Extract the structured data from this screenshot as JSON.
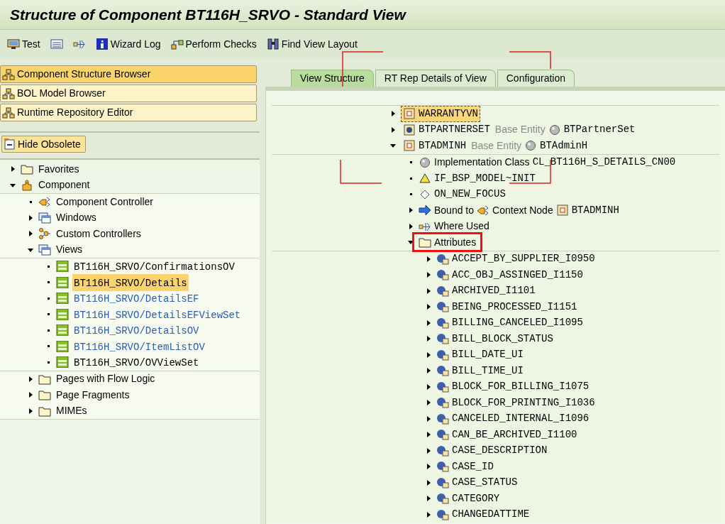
{
  "window": {
    "title": "Structure of Component BT116H_SRVO - Standard View"
  },
  "toolbar": [
    {
      "kind": "test",
      "label": "Test"
    },
    {
      "kind": "list"
    },
    {
      "kind": "where-used"
    },
    {
      "kind": "info",
      "label": "Wizard Log"
    },
    {
      "kind": "checks",
      "label": "Perform Checks"
    },
    {
      "kind": "binoculars",
      "label": "Find View Layout"
    }
  ],
  "browsers": [
    {
      "label": "Component Structure Browser",
      "selected": true
    },
    {
      "label": "BOL Model Browser",
      "selected": false
    },
    {
      "label": "Runtime Repository Editor",
      "selected": false
    }
  ],
  "hide_obsolete_button": "Hide Obsolete",
  "left_tree": [
    {
      "kind": "folder",
      "label": "Favorites",
      "expanded": false
    },
    {
      "kind": "component",
      "label": "Component",
      "expanded": true,
      "children": [
        {
          "kind": "controller",
          "label": "Component Controller"
        },
        {
          "kind": "window",
          "label": "Windows",
          "expanded": false
        },
        {
          "kind": "custom",
          "label": "Custom Controllers",
          "expanded": false
        },
        {
          "kind": "window",
          "label": "Views",
          "expanded": true,
          "children": [
            {
              "kind": "view",
              "label": "BT116H_SRVO/ConfirmationsOV",
              "selected": false,
              "color": "#000000"
            },
            {
              "kind": "view",
              "label": "BT116H_SRVO/Details",
              "selected": true,
              "color": "#000000"
            },
            {
              "kind": "view",
              "label": "BT116H_SRVO/DetailsEF",
              "selected": false,
              "color": "#2a5cb8"
            },
            {
              "kind": "view",
              "label": "BT116H_SRVO/DetailsEFViewSet",
              "selected": false,
              "color": "#2a5cb8"
            },
            {
              "kind": "view",
              "label": "BT116H_SRVO/DetailsOV",
              "selected": false,
              "color": "#2a5cb8"
            },
            {
              "kind": "view",
              "label": "BT116H_SRVO/ItemListOV",
              "selected": false,
              "color": "#2a5cb8"
            },
            {
              "kind": "view",
              "label": "BT116H_SRVO/OVViewSet",
              "selected": false,
              "color": "#000000"
            }
          ]
        },
        {
          "kind": "folder",
          "label": "Pages with Flow Logic",
          "expanded": false
        },
        {
          "kind": "folder",
          "label": "Page Fragments",
          "expanded": false
        },
        {
          "kind": "folder",
          "label": "MIMEs",
          "expanded": false
        }
      ]
    }
  ],
  "tabs": [
    {
      "label": "View Structure",
      "selected": true
    },
    {
      "label": "RT Rep Details of View",
      "selected": false
    },
    {
      "label": "Configuration",
      "selected": false
    }
  ],
  "structure_tree": [
    {
      "kind": "context-node",
      "label": "WARRANTYVN",
      "expanded": false,
      "selected": true
    },
    {
      "kind": "model-node",
      "label": "BTPARTNERSET",
      "note": "Base Entity",
      "entity": "BTPartnerSet",
      "expanded": false,
      "selected": false
    },
    {
      "kind": "context-node",
      "label": "BTADMINH",
      "note": "Base Entity",
      "entity": "BTAdminH",
      "expanded": true,
      "selected": false,
      "children": [
        {
          "kind": "class",
          "label": "Implementation Class",
          "value": "CL_BT116H_S_DETAILS_CN00"
        },
        {
          "kind": "method-warning",
          "label": "IF_BSP_MODEL~INIT"
        },
        {
          "kind": "method",
          "label": "ON_NEW_FOCUS"
        },
        {
          "kind": "binding",
          "label": "Bound to",
          "target_label": "Context Node",
          "target": "BTADMINH",
          "expanded": false
        },
        {
          "kind": "where-used",
          "label": "Where Used",
          "expanded": false
        },
        {
          "kind": "folder",
          "label": "Attributes",
          "expanded": true,
          "highlighted": true,
          "children": [
            {
              "kind": "attribute",
              "label": "ACCEPT_BY_SUPPLIER_I0950",
              "expanded": false
            },
            {
              "kind": "attribute",
              "label": "ACC_OBJ_ASSINGED_I1150",
              "expanded": false
            },
            {
              "kind": "attribute",
              "label": "ARCHIVED_I1101",
              "expanded": false
            },
            {
              "kind": "attribute",
              "label": "BEING_PROCESSED_I1151",
              "expanded": false
            },
            {
              "kind": "attribute",
              "label": "BILLING_CANCELED_I1095",
              "expanded": false
            },
            {
              "kind": "attribute",
              "label": "BILL_BLOCK_STATUS",
              "expanded": false
            },
            {
              "kind": "attribute",
              "label": "BILL_DATE_UI",
              "expanded": false
            },
            {
              "kind": "attribute",
              "label": "BILL_TIME_UI",
              "expanded": false
            },
            {
              "kind": "attribute",
              "label": "BLOCK_FOR_BILLING_I1075",
              "expanded": false
            },
            {
              "kind": "attribute",
              "label": "BLOCK_FOR_PRINTING_I1036",
              "expanded": false
            },
            {
              "kind": "attribute",
              "label": "CANCELED_INTERNAL_I1096",
              "expanded": false
            },
            {
              "kind": "attribute",
              "label": "CAN_BE_ARCHIVED_I1100",
              "expanded": false
            },
            {
              "kind": "attribute",
              "label": "CASE_DESCRIPTION",
              "expanded": false
            },
            {
              "kind": "attribute",
              "label": "CASE_ID",
              "expanded": false
            },
            {
              "kind": "attribute",
              "label": "CASE_STATUS",
              "expanded": false
            },
            {
              "kind": "attribute",
              "label": "CATEGORY",
              "expanded": false
            },
            {
              "kind": "attribute",
              "label": "CHANGEDATTIME",
              "expanded": false
            }
          ]
        }
      ]
    }
  ]
}
